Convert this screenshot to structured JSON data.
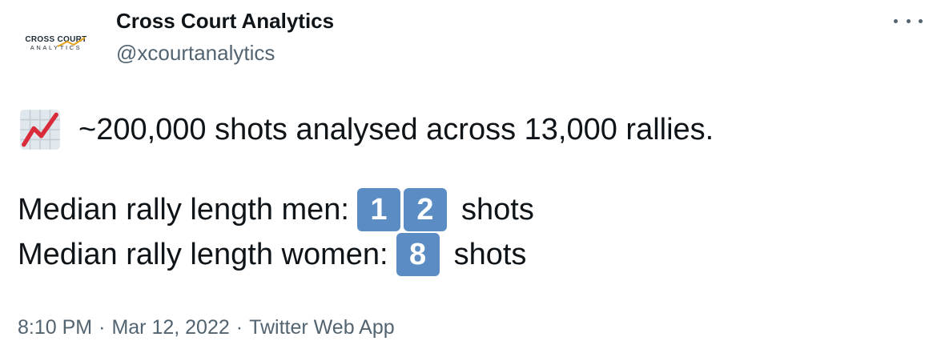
{
  "author": {
    "display_name": "Cross Court Analytics",
    "handle": "@xcourtanalytics",
    "avatar": {
      "line1": "CROSS COURT",
      "line2": "ANALYTICS",
      "swoosh_color": "#e7a21a"
    }
  },
  "more_icon": "more-horizontal-icon",
  "tweet": {
    "line1_icon": "chart-increasing-emoji",
    "line1_text": "~200,000 shots analysed across 13,000 rallies.",
    "men": {
      "label": "Median rally length men:",
      "keycaps": [
        "1",
        "2"
      ],
      "unit": "shots"
    },
    "women": {
      "label": "Median rally length women:",
      "keycaps": [
        "8"
      ],
      "unit": "shots"
    }
  },
  "meta": {
    "time": "8:10 PM",
    "separator": "·",
    "date": "Mar 12, 2022",
    "source": "Twitter Web App"
  },
  "colors": {
    "text": "#0f1419",
    "secondary": "#536471",
    "keycap": "#5b8dc4",
    "chart_line": "#d92b3a"
  }
}
